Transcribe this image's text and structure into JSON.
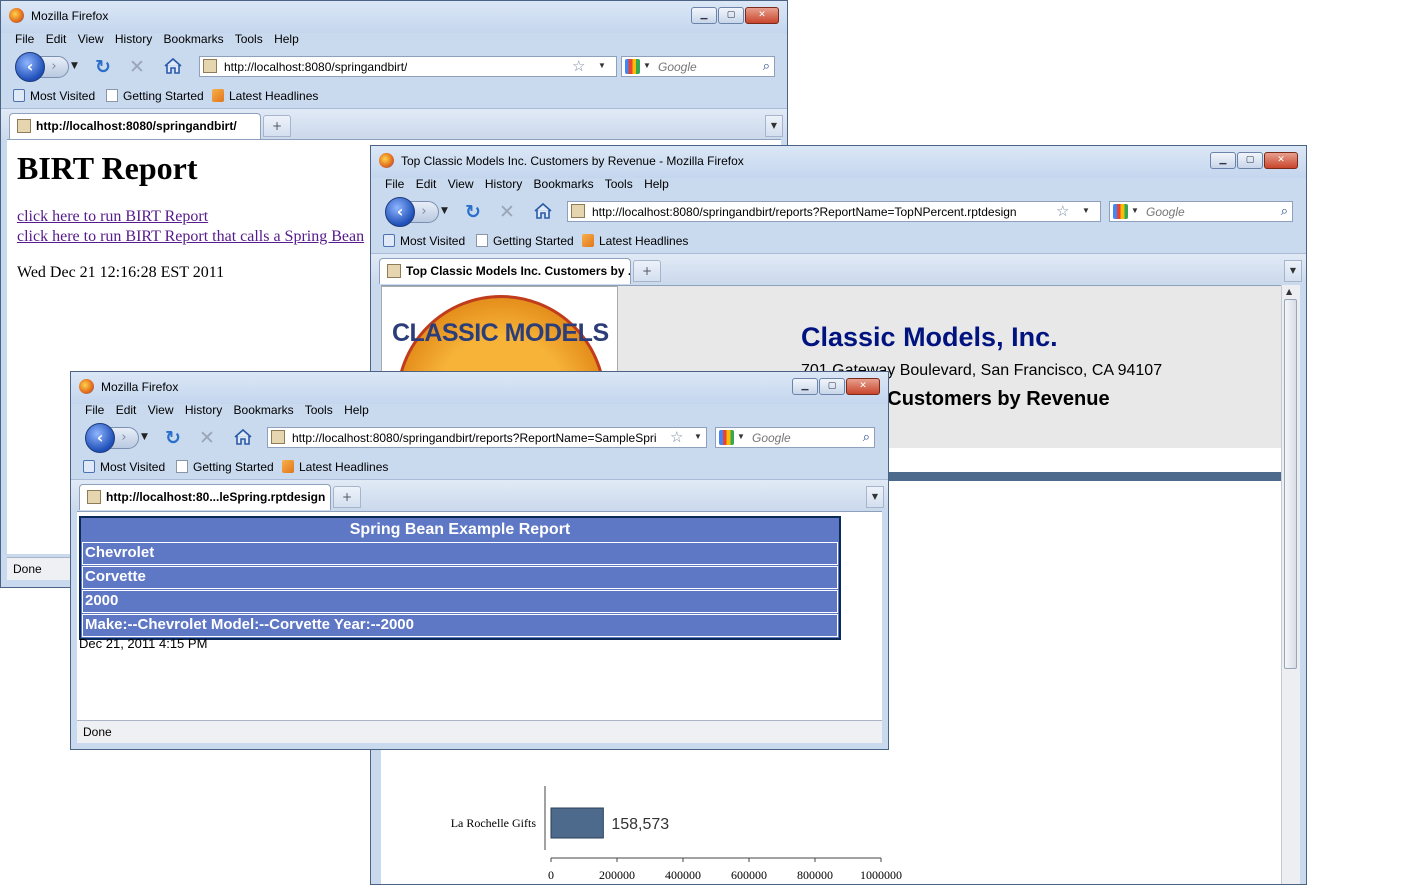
{
  "browser": {
    "title": "Mozilla Firefox",
    "menus": [
      "File",
      "Edit",
      "View",
      "History",
      "Bookmarks",
      "Tools",
      "Help"
    ],
    "bookmarks": [
      "Most Visited",
      "Getting Started",
      "Latest Headlines"
    ],
    "search_placeholder": "Google",
    "status": "Done"
  },
  "window1": {
    "title": "Mozilla Firefox",
    "url": "http://localhost:8080/springandbirt/",
    "tab": "http://localhost:8080/springandbirt/",
    "heading": "BIRT Report",
    "link1": "click here to run BIRT Report",
    "link2": "click here to run BIRT Report that calls a Spring Bean",
    "date": "Wed Dec 21 12:16:28 EST 2011",
    "status": "Done"
  },
  "window2": {
    "title": "Top Classic Models Inc. Customers by Revenue - Mozilla Firefox",
    "url": "http://localhost:8080/springandbirt/reports?ReportName=TopNPercent.rptdesign",
    "tab": "Top Classic Models Inc. Customers by ...",
    "logo_text": "CLASSIC MODELS",
    "company": "Classic Models, Inc.",
    "address": "701 Gateway Boulevard, San Francisco, CA 94107",
    "subtitle": "Top 25% Customers by Revenue"
  },
  "window3": {
    "title": "Mozilla Firefox",
    "url": "http://localhost:8080/springandbirt/reports?ReportName=SampleSpri",
    "tab": "http://localhost:80...leSpring.rptdesign",
    "report_title": "Spring Bean Example Report",
    "rows": [
      "Chevrolet",
      "Corvette",
      "2000",
      "Make:--Chevrolet Model:--Corvette Year:--2000"
    ],
    "date": "Dec 21, 2011 4:15 PM",
    "status": "Done"
  },
  "chart_data": {
    "type": "bar",
    "orientation": "horizontal",
    "categories": [
      "La Rochelle Gifts"
    ],
    "values": [
      158573
    ],
    "data_labels": [
      "158,573"
    ],
    "xlim": [
      0,
      1000000
    ],
    "xticks": [
      "0",
      "200000",
      "400000",
      "600000",
      "800000",
      "1000000"
    ],
    "colors": {
      "bar": "#4d6a8d"
    }
  }
}
